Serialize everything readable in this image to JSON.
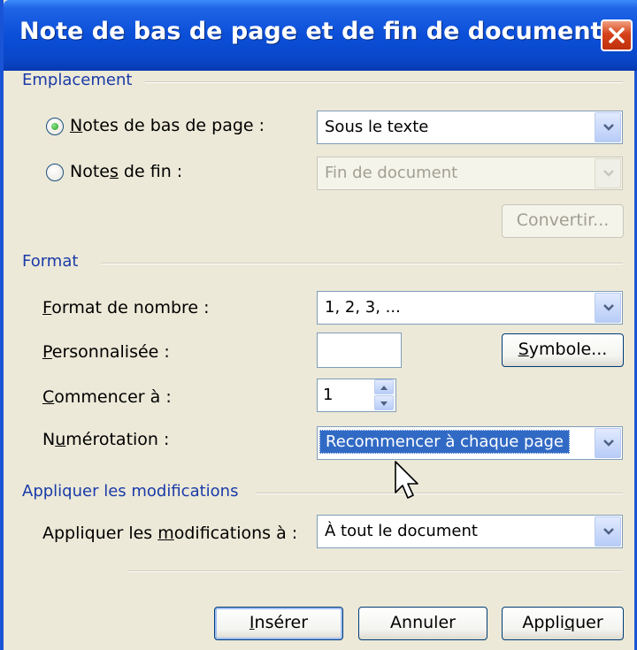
{
  "window": {
    "title": "Note de bas de page et de fin de document"
  },
  "emplacement": {
    "label": "Emplacement",
    "footnotes": {
      "pre": "",
      "acc": "N",
      "post": "otes de bas de page :",
      "selected": true,
      "value": "Sous le texte"
    },
    "endnotes": {
      "pre": "Note",
      "acc": "s",
      "post": " de fin :",
      "selected": false,
      "value": "Fin de document"
    },
    "convert_label": "Convertir..."
  },
  "format": {
    "label": "Format",
    "number_format": {
      "pre": "",
      "acc": "F",
      "post": "ormat de nombre :",
      "value": "1, 2, 3, ..."
    },
    "custom": {
      "pre": "",
      "acc": "P",
      "post": "ersonnalisée :",
      "value": ""
    },
    "symbol_button": {
      "pre": "",
      "acc": "S",
      "post": "ymbole..."
    },
    "start_at": {
      "pre": "",
      "acc": "C",
      "post": "ommencer à :",
      "value": "1"
    },
    "numbering": {
      "pre": "N",
      "acc": "u",
      "post": "mérotation :",
      "value": "Recommencer à chaque page"
    }
  },
  "apply": {
    "label": "Appliquer les modifications",
    "apply_to": {
      "pre": "Appliquer les ",
      "acc": "m",
      "post": "odifications à :",
      "value": "À tout le document"
    }
  },
  "buttons": {
    "insert": {
      "pre": "",
      "acc": "I",
      "post": "nsérer"
    },
    "cancel": {
      "label": "Annuler"
    },
    "apply": {
      "pre": "Appli",
      "acc": "q",
      "post": "uer"
    }
  },
  "colors": {
    "title_bar": "#0b4fd8",
    "group_label": "#1a3aa8",
    "selection": "#316ac5"
  }
}
